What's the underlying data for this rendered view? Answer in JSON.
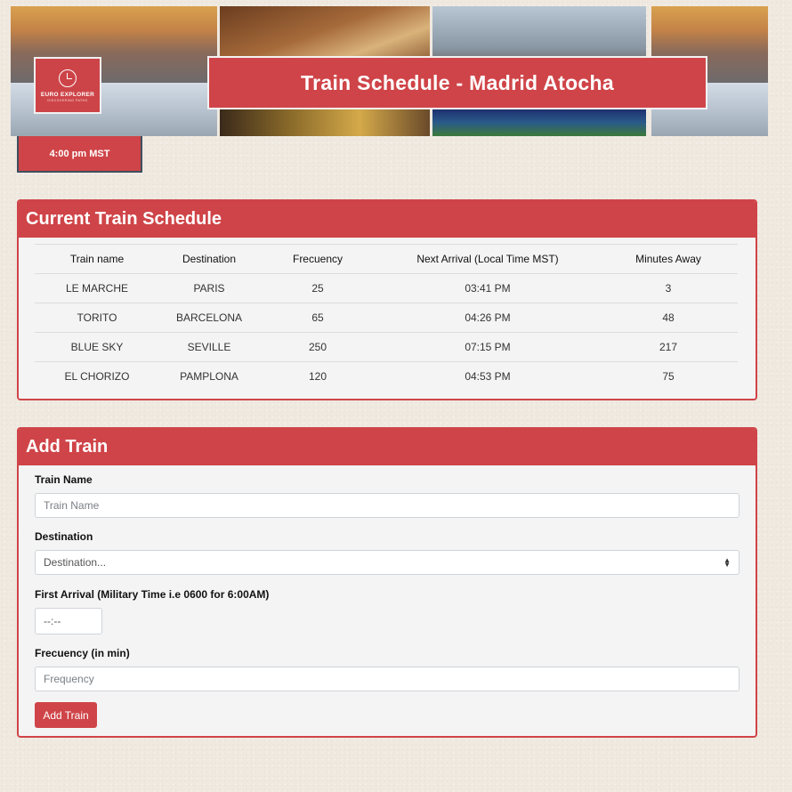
{
  "header": {
    "logo_name": "EURO EXPLORER",
    "logo_tagline": "DISCOVERING PATHS",
    "title": "Train Schedule - Madrid Atocha",
    "current_time": "4:00 pm MST"
  },
  "schedule": {
    "heading": "Current Train Schedule",
    "columns": [
      "Train name",
      "Destination",
      "Frecuency",
      "Next Arrival (Local Time MST)",
      "Minutes Away"
    ],
    "rows": [
      [
        "LE MARCHE",
        "PARIS",
        "25",
        "03:41 PM",
        "3"
      ],
      [
        "TORITO",
        "BARCELONA",
        "65",
        "04:26 PM",
        "48"
      ],
      [
        "BLUE SKY",
        "SEVILLE",
        "250",
        "07:15 PM",
        "217"
      ],
      [
        "EL CHORIZO",
        "PAMPLONA",
        "120",
        "04:53 PM",
        "75"
      ]
    ]
  },
  "add_train": {
    "heading": "Add Train",
    "train_name_label": "Train Name",
    "train_name_placeholder": "Train Name",
    "destination_label": "Destination",
    "destination_selected": "Destination...",
    "first_arrival_label": "First Arrival (Military Time i.e 0600 for 6:00AM)",
    "first_arrival_value": "--:--",
    "frequency_label": "Frecuency (in min)",
    "frequency_placeholder": "Frequency",
    "submit_label": "Add Train"
  },
  "colors": {
    "accent": "#cf4448",
    "page_background": "#efe9e0",
    "card_background": "#f4f4f4"
  }
}
